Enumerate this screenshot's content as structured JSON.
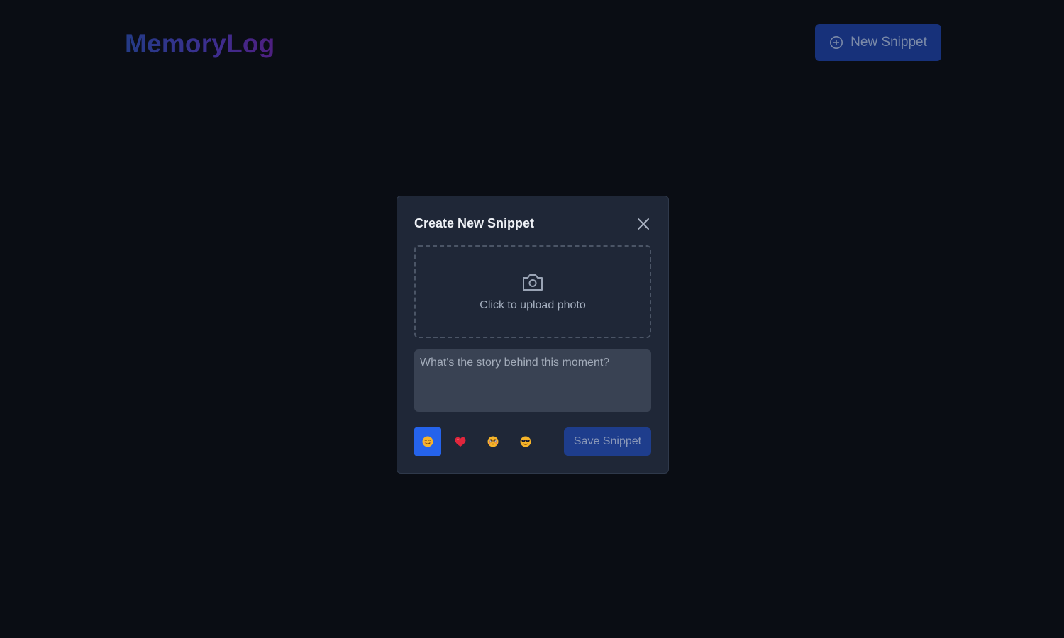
{
  "header": {
    "logo_text": "MemoryLog",
    "new_snippet_label": "New Snippet"
  },
  "modal": {
    "title": "Create New Snippet",
    "upload_label": "Click to upload photo",
    "story_placeholder": "What's the story behind this moment?",
    "save_label": "Save Snippet",
    "moods": [
      {
        "icon": "smiling-face-icon",
        "selected": true
      },
      {
        "icon": "red-heart-icon",
        "selected": false
      },
      {
        "icon": "flushed-face-icon",
        "selected": false
      },
      {
        "icon": "sunglasses-face-icon",
        "selected": false
      }
    ]
  },
  "colors": {
    "background": "#0a0d14",
    "modal_background": "#1f2737",
    "primary_button": "#17317a",
    "selected_mood": "#2563eb",
    "save_button": "#1e3d8c"
  }
}
